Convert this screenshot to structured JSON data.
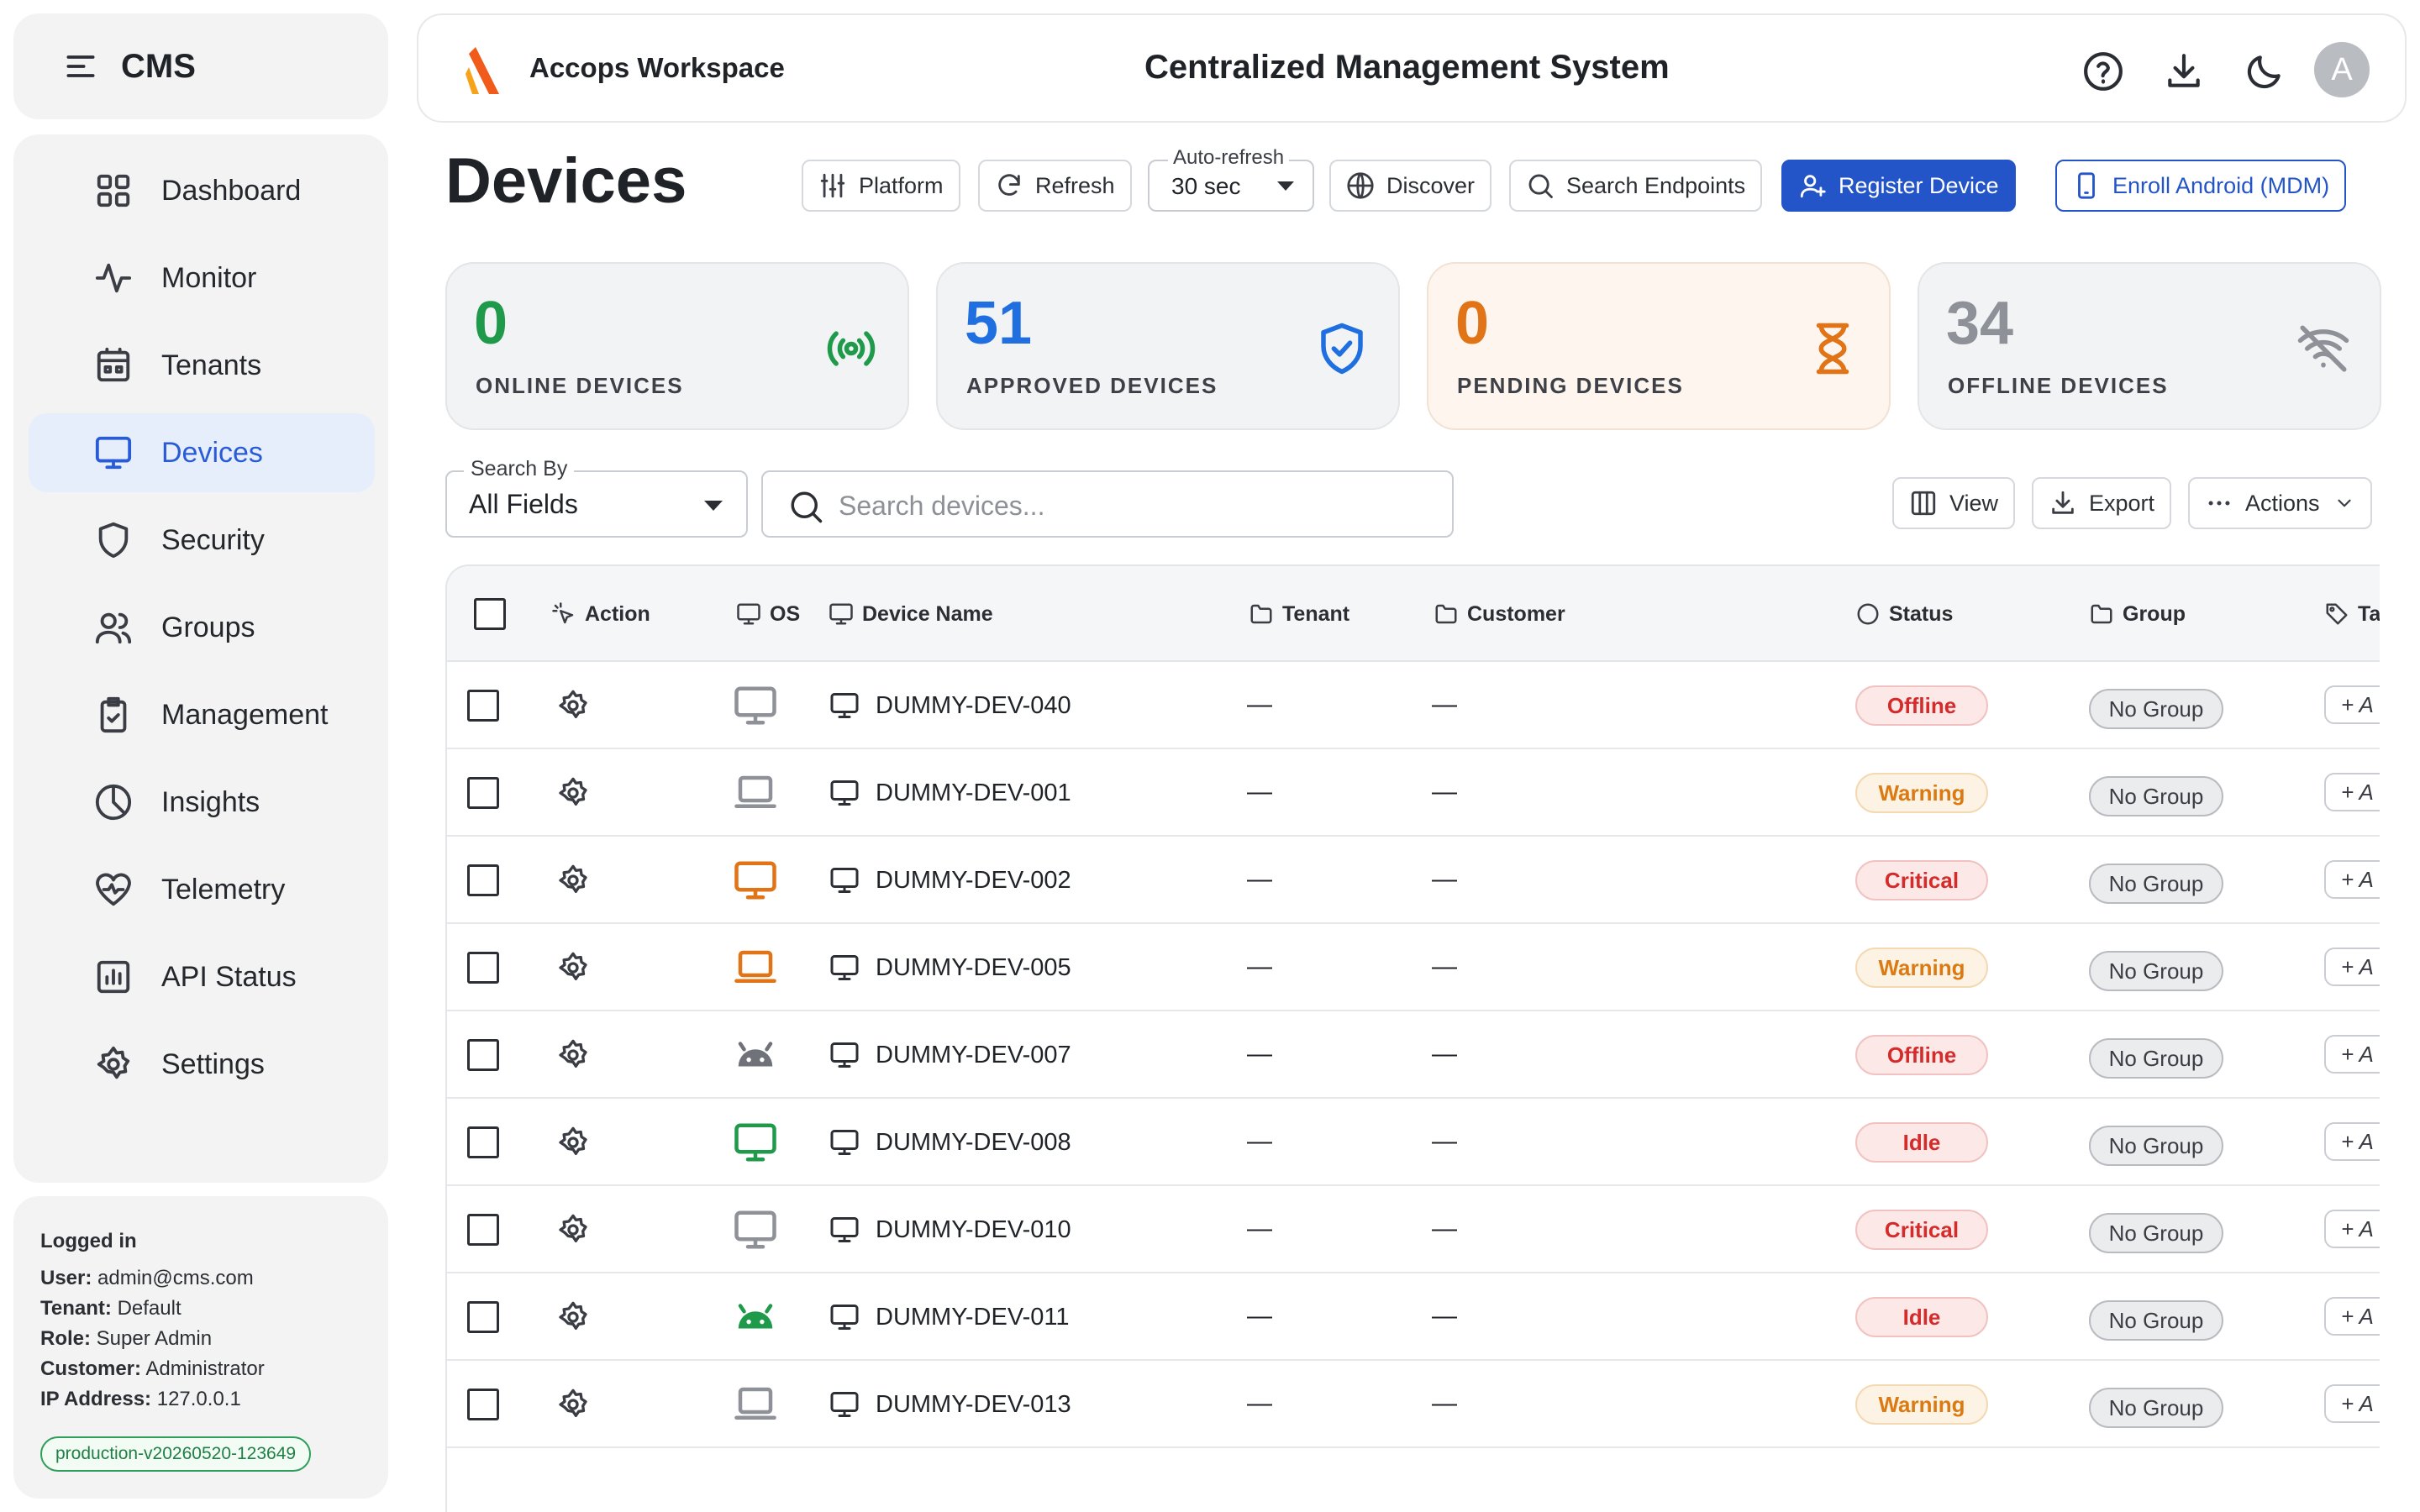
{
  "sidebar": {
    "brand": "CMS",
    "items": [
      {
        "label": "Dashboard"
      },
      {
        "label": "Monitor"
      },
      {
        "label": "Tenants"
      },
      {
        "label": "Devices"
      },
      {
        "label": "Security"
      },
      {
        "label": "Groups"
      },
      {
        "label": "Management"
      },
      {
        "label": "Insights"
      },
      {
        "label": "Telemetry"
      },
      {
        "label": "API Status"
      },
      {
        "label": "Settings"
      }
    ],
    "active": "Devices",
    "user_info": {
      "logged_in": "Logged in",
      "user_label": "User:",
      "user": "admin@cms.com",
      "tenant_label": "Tenant:",
      "tenant": "Default",
      "role_label": "Role:",
      "role": "Super Admin",
      "customer_label": "Customer:",
      "customer": "Administrator",
      "ip_label": "IP Address:",
      "ip": "127.0.0.1",
      "version": "production-v20260520-123649"
    }
  },
  "topbar": {
    "workspace": "Accops Workspace",
    "title": "Centralized Management System",
    "avatar_initial": "A",
    "icons": [
      "help-circle-icon",
      "download-icon",
      "moon-icon"
    ]
  },
  "page": {
    "title": "Devices",
    "toolbar": {
      "platform": "Platform",
      "refresh": "Refresh",
      "auto_refresh_label": "Auto-refresh",
      "auto_refresh_value": "30 sec",
      "discover": "Discover",
      "search_endpoints": "Search Endpoints",
      "register_device": "Register Device",
      "enroll_android": "Enroll Android (MDM)"
    }
  },
  "stats": [
    {
      "value": "0",
      "label": "ONLINE DEVICES",
      "color": "#1e9a4a",
      "icon": "broadcast-icon"
    },
    {
      "value": "51",
      "label": "APPROVED DEVICES",
      "color": "#1f6fe0",
      "icon": "shield-check-icon"
    },
    {
      "value": "0",
      "label": "PENDING DEVICES",
      "color": "#e07416",
      "icon": "hourglass-icon"
    },
    {
      "value": "34",
      "label": "OFFLINE DEVICES",
      "color": "#8e9197",
      "icon": "wifi-off-icon"
    }
  ],
  "search": {
    "by_label": "Search By",
    "by_value": "All Fields",
    "placeholder": "Search devices...",
    "view": "View",
    "export": "Export",
    "actions": "Actions"
  },
  "table": {
    "columns": {
      "action": "Action",
      "os": "OS",
      "device_name": "Device Name",
      "tenant": "Tenant",
      "customer": "Customer",
      "status": "Status",
      "group": "Group",
      "tags": "Ta"
    },
    "rows": [
      {
        "os": "monitor",
        "os_color": "#8e9197",
        "name": "DUMMY-DEV-040",
        "tenant": "—",
        "customer": "—",
        "status": "Offline",
        "group": "No Group",
        "tag": "+ A"
      },
      {
        "os": "laptop",
        "os_color": "#8e9197",
        "name": "DUMMY-DEV-001",
        "tenant": "—",
        "customer": "—",
        "status": "Warning",
        "group": "No Group",
        "tag": "+ A"
      },
      {
        "os": "monitor",
        "os_color": "#e07416",
        "name": "DUMMY-DEV-002",
        "tenant": "—",
        "customer": "—",
        "status": "Critical",
        "group": "No Group",
        "tag": "+ A"
      },
      {
        "os": "laptop",
        "os_color": "#e07416",
        "name": "DUMMY-DEV-005",
        "tenant": "—",
        "customer": "—",
        "status": "Warning",
        "group": "No Group",
        "tag": "+ A"
      },
      {
        "os": "android",
        "os_color": "#6f7279",
        "name": "DUMMY-DEV-007",
        "tenant": "—",
        "customer": "—",
        "status": "Offline",
        "group": "No Group",
        "tag": "+ A"
      },
      {
        "os": "monitor",
        "os_color": "#1e9a4a",
        "name": "DUMMY-DEV-008",
        "tenant": "—",
        "customer": "—",
        "status": "Idle",
        "group": "No Group",
        "tag": "+ A"
      },
      {
        "os": "monitor",
        "os_color": "#8e9197",
        "name": "DUMMY-DEV-010",
        "tenant": "—",
        "customer": "—",
        "status": "Critical",
        "group": "No Group",
        "tag": "+ A"
      },
      {
        "os": "android",
        "os_color": "#1e9a4a",
        "name": "DUMMY-DEV-011",
        "tenant": "—",
        "customer": "—",
        "status": "Idle",
        "group": "No Group",
        "tag": "+ A"
      },
      {
        "os": "laptop",
        "os_color": "#8e9197",
        "name": "DUMMY-DEV-013",
        "tenant": "—",
        "customer": "—",
        "status": "Warning",
        "group": "No Group",
        "tag": "+ A"
      }
    ]
  }
}
